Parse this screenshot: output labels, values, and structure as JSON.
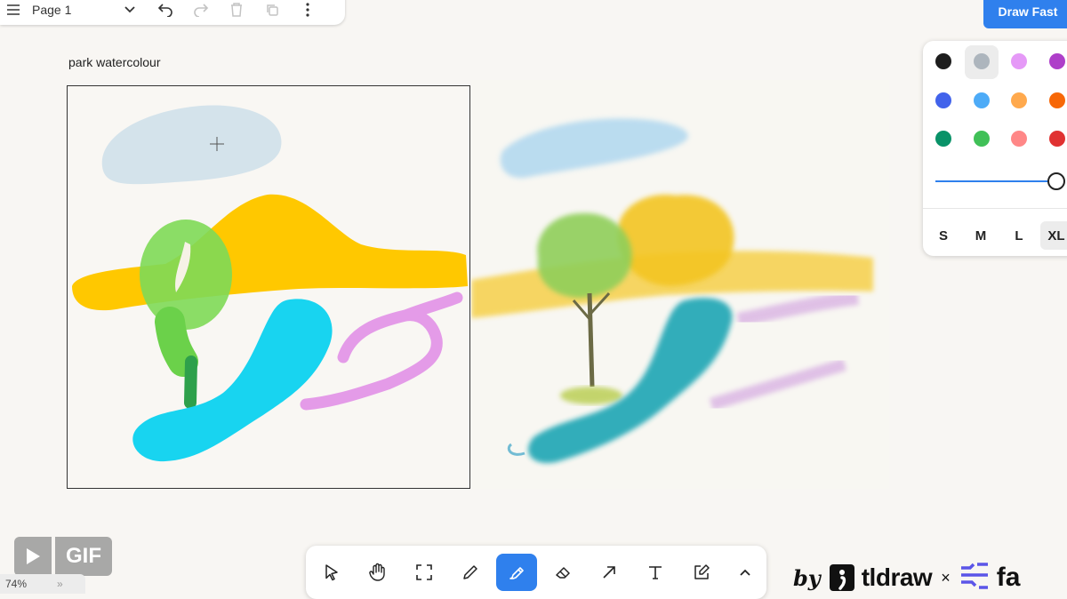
{
  "top_menu": {
    "page_name": "Page 1",
    "icons": [
      "hamburger-menu-icon",
      "chevron-down-icon",
      "undo-icon",
      "redo-icon",
      "trash-icon",
      "duplicate-icon",
      "more-vertical-icon"
    ]
  },
  "draw_fast_button": {
    "label": "Draw Fast",
    "color": "#2f80ed"
  },
  "frame": {
    "label": "park watercolour"
  },
  "style_panel": {
    "colors": [
      "#1d1d1d",
      "#adb5bd",
      "#e599f7",
      "#ae3ec9",
      "#4263eb",
      "#4dabf7",
      "#ffa94d",
      "#f76707",
      "#099268",
      "#40c057",
      "#ff8787",
      "#e03131"
    ],
    "selected_color_index": 1,
    "opacity": 1.0,
    "sizes": [
      "S",
      "M",
      "L",
      "XL"
    ],
    "selected_size": "XL"
  },
  "toolbar": {
    "tools": [
      {
        "name": "select",
        "icon": "cursor-icon"
      },
      {
        "name": "hand",
        "icon": "hand-icon"
      },
      {
        "name": "frame",
        "icon": "frame-icon"
      },
      {
        "name": "draw",
        "icon": "pencil-icon"
      },
      {
        "name": "highlight",
        "icon": "highlighter-icon"
      },
      {
        "name": "eraser",
        "icon": "eraser-icon"
      },
      {
        "name": "arrow",
        "icon": "arrow-icon"
      },
      {
        "name": "text",
        "icon": "text-icon"
      },
      {
        "name": "note",
        "icon": "note-edit-icon"
      },
      {
        "name": "more",
        "icon": "chevron-up-icon"
      }
    ],
    "active_tool": "highlight",
    "accent": "#2f80ed"
  },
  "gif_badge": {
    "label": "GIF"
  },
  "zoom": {
    "value": "74%"
  },
  "branding": {
    "by": "by",
    "tldraw": "tldraw",
    "x": "×",
    "fal": "fa"
  }
}
